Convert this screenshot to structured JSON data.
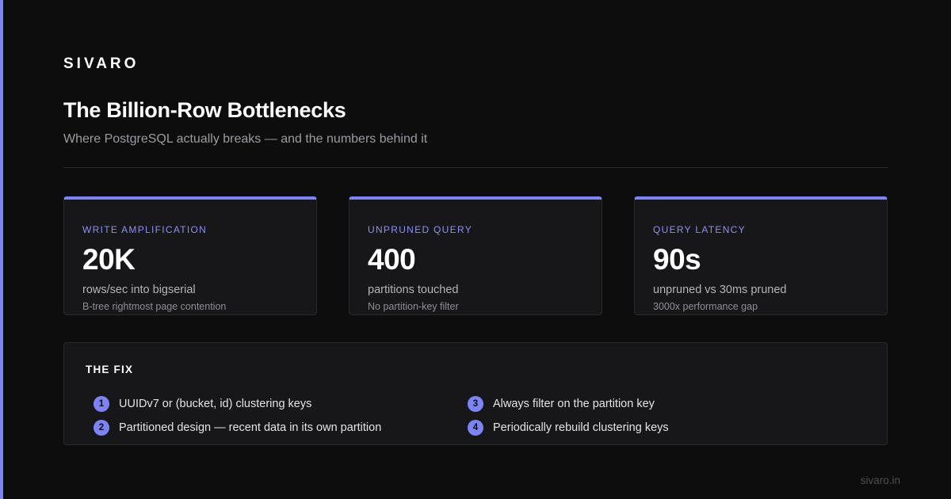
{
  "brand": "SIVARO",
  "title": "The Billion-Row Bottlenecks",
  "subtitle": "Where PostgreSQL actually breaks — and the numbers behind it",
  "colors": {
    "accent": "#7c83f5",
    "background": "#0d0d0e",
    "card": "#17171a"
  },
  "cards": [
    {
      "label": "WRITE AMPLIFICATION",
      "value": "20K",
      "desc": "rows/sec into bigserial",
      "note": "B-tree rightmost page contention"
    },
    {
      "label": "UNPRUNED QUERY",
      "value": "400",
      "desc": "partitions touched",
      "note": "No partition-key filter"
    },
    {
      "label": "QUERY LATENCY",
      "value": "90s",
      "desc": "unpruned vs 30ms pruned",
      "note": "3000x performance gap"
    }
  ],
  "fix": {
    "title": "THE FIX",
    "items": [
      {
        "num": "1",
        "text": "UUIDv7 or (bucket, id) clustering keys"
      },
      {
        "num": "2",
        "text": "Partitioned design — recent data in its own partition"
      },
      {
        "num": "3",
        "text": "Always filter on the partition key"
      },
      {
        "num": "4",
        "text": "Periodically rebuild clustering keys"
      }
    ]
  },
  "footer": "sivaro.in"
}
